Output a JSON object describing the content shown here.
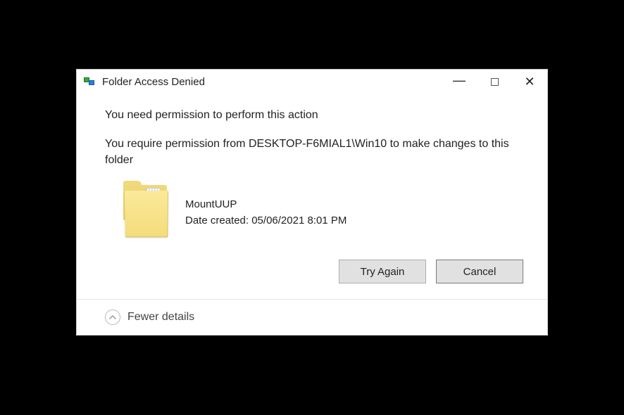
{
  "titlebar": {
    "title": "Folder Access Denied"
  },
  "content": {
    "heading": "You need permission to perform this action",
    "message": "You require permission from DESKTOP-F6MIAL1\\Win10 to make changes to this folder",
    "folder": {
      "name": "MountUUP",
      "date_label": "Date created: ",
      "date_value": "05/06/2021 8:01 PM"
    }
  },
  "buttons": {
    "try_again": "Try Again",
    "cancel": "Cancel"
  },
  "footer": {
    "toggle_label": "Fewer details"
  }
}
